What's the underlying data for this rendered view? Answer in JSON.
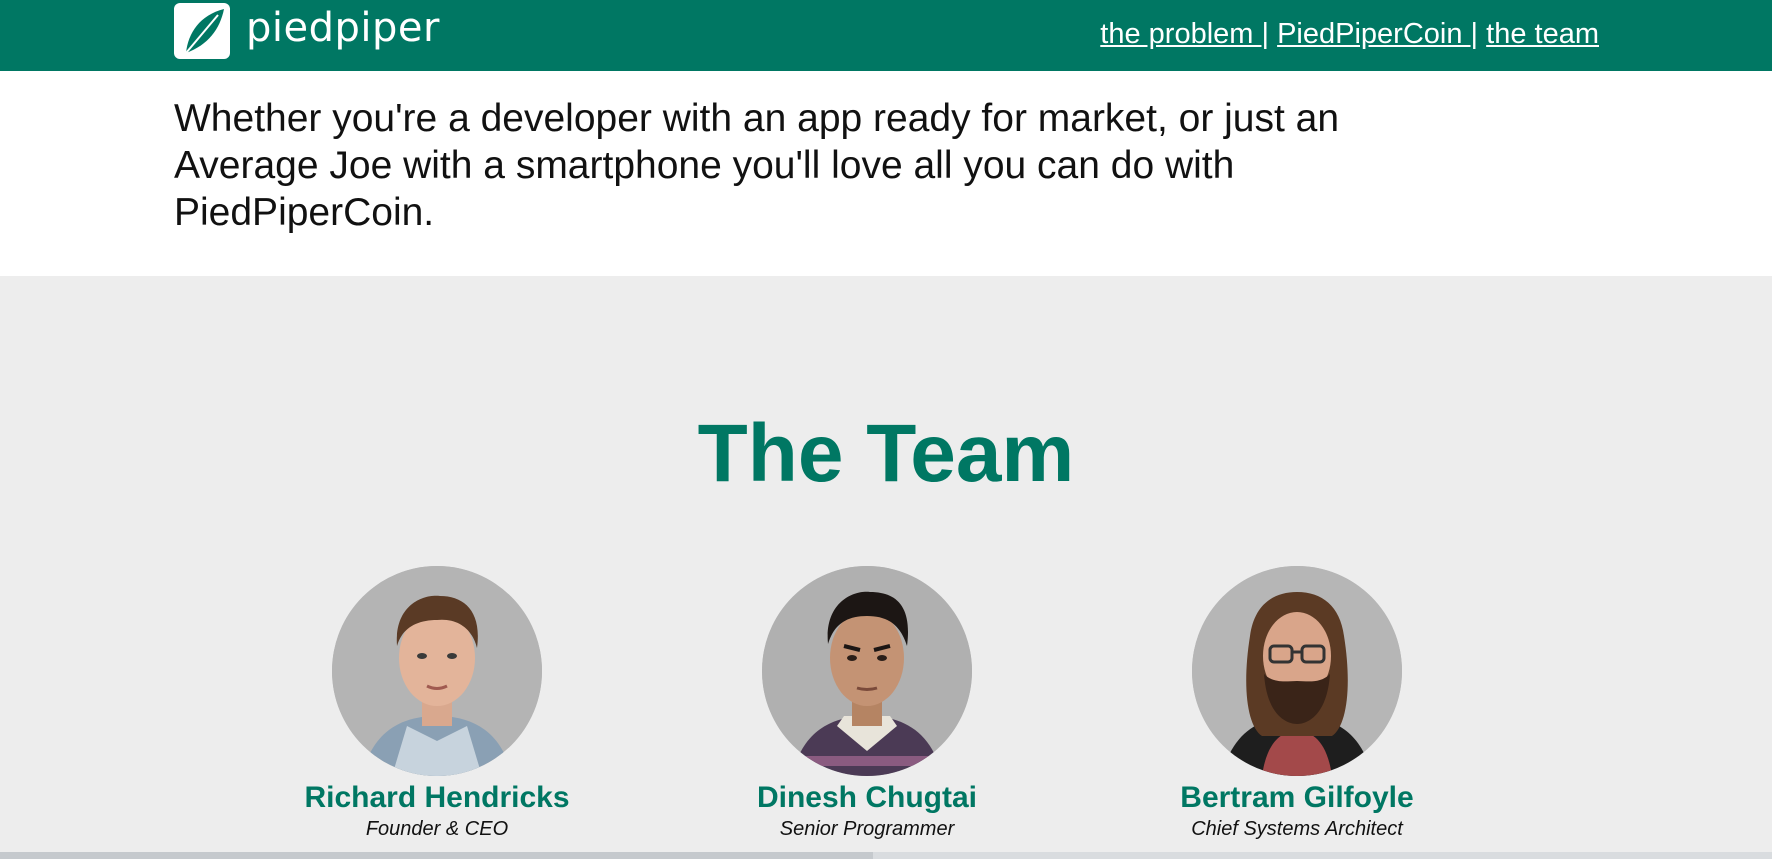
{
  "brand": {
    "name": "piedpiper",
    "color": "#007763"
  },
  "nav": {
    "items": [
      {
        "label": "the problem "
      },
      {
        "label": "PiedPiperCoin "
      },
      {
        "label": "the team"
      }
    ],
    "separator": "|"
  },
  "intro": {
    "text": "Whether you're a developer with an app ready for market, or just an Average Joe with a smartphone you'll love all you can do with PiedPiperCoin."
  },
  "team": {
    "title": "The Team",
    "members": [
      {
        "name": "Richard Hendricks",
        "role": "Founder & CEO",
        "photo": "portrait-photo"
      },
      {
        "name": "Dinesh Chugtai",
        "role": "Senior Programmer",
        "photo": "portrait-photo"
      },
      {
        "name": "Bertram Gilfoyle",
        "role": "Chief Systems Architect",
        "photo": "portrait-photo"
      }
    ]
  }
}
